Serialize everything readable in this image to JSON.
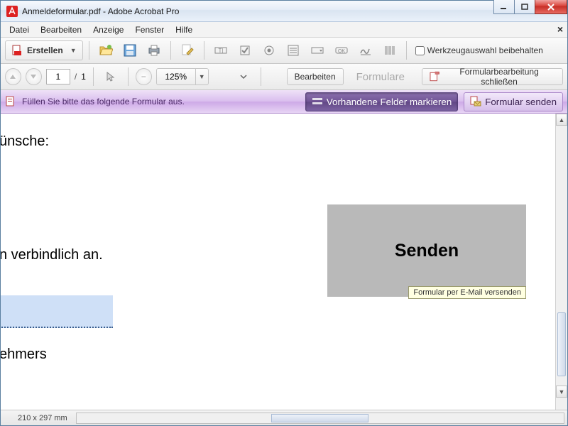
{
  "window": {
    "title": "Anmeldeformular.pdf - Adobe Acrobat Pro"
  },
  "menu": {
    "items": [
      "Datei",
      "Bearbeiten",
      "Anzeige",
      "Fenster",
      "Hilfe"
    ]
  },
  "toolbar1": {
    "erstellen": "Erstellen",
    "werkzeugauswahl": "Werkzeugauswahl beibehalten"
  },
  "toolbar2": {
    "page_current": "1",
    "page_total": "1",
    "zoom": "125%",
    "bearbeiten": "Bearbeiten",
    "formulare": "Formulare",
    "close_form": "Formularbearbeitung schließen"
  },
  "formbar": {
    "msg": "Füllen Sie bitte das folgende Formular aus.",
    "highlight": "Vorhandene Felder markieren",
    "send": "Formular senden"
  },
  "document": {
    "t1": "ünsche:",
    "t2": "n verbindlich an.",
    "t3": "ehmers",
    "send_button": "Senden",
    "tooltip": "Formular per E-Mail versenden"
  },
  "status": {
    "dims": "210 x 297 mm"
  }
}
